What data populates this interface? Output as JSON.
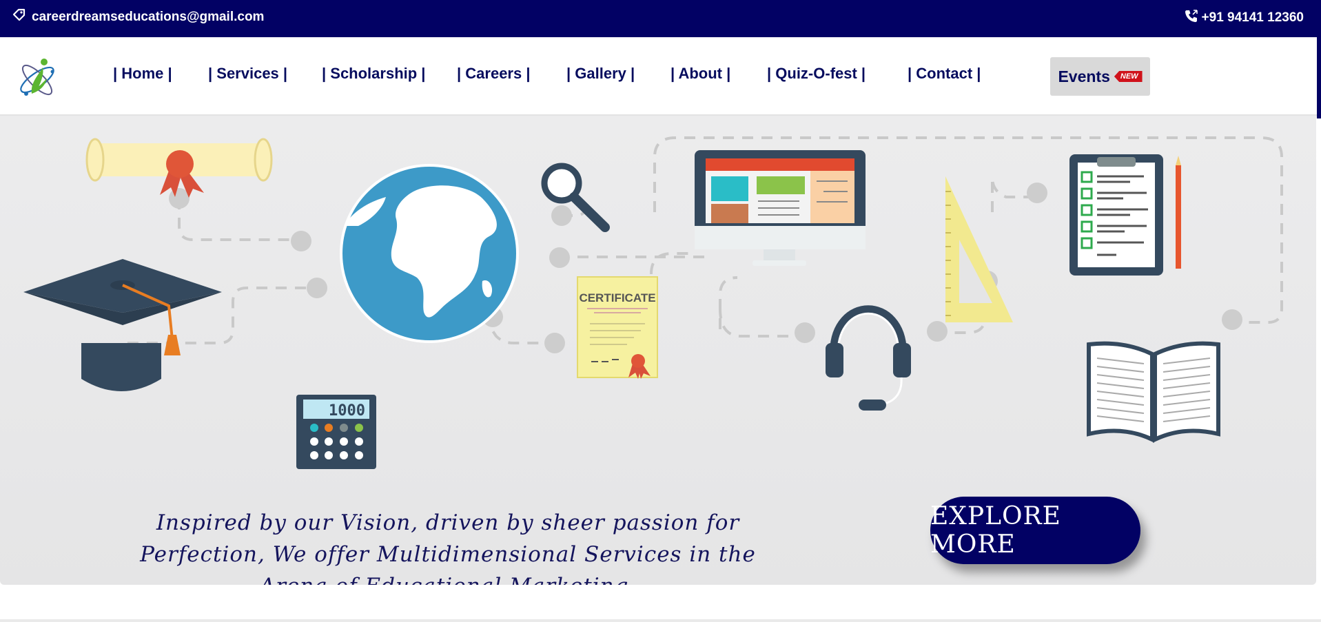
{
  "topbar": {
    "email": "careerdreamseducations@gmail.com",
    "email_icon": "tag-icon",
    "phone": "+91 94141 12360",
    "phone_icon": "phone-icon"
  },
  "nav": {
    "items": [
      {
        "label": "| Home |"
      },
      {
        "label": "| Services |"
      },
      {
        "label": "| Scholarship |"
      },
      {
        "label": "| Careers |"
      },
      {
        "label": "| Gallery |"
      },
      {
        "label": "| About |"
      },
      {
        "label": "| Quiz-O-fest |"
      },
      {
        "label": "| Contact |"
      }
    ],
    "events_label": "Events",
    "new_badge": "NEW"
  },
  "hero": {
    "tagline": "Inspired by our Vision, driven by sheer passion for Perfection, We offer Multidimensional Services in the Arena of Educational Marketing.",
    "certificate_text": "CERTIFICATE",
    "calculator_display": "1000",
    "explore_label": "EXPLORE MORE"
  },
  "colors": {
    "brand_navy": "#020164",
    "nav_text": "#060c5e",
    "badge_red": "#d0121b"
  }
}
